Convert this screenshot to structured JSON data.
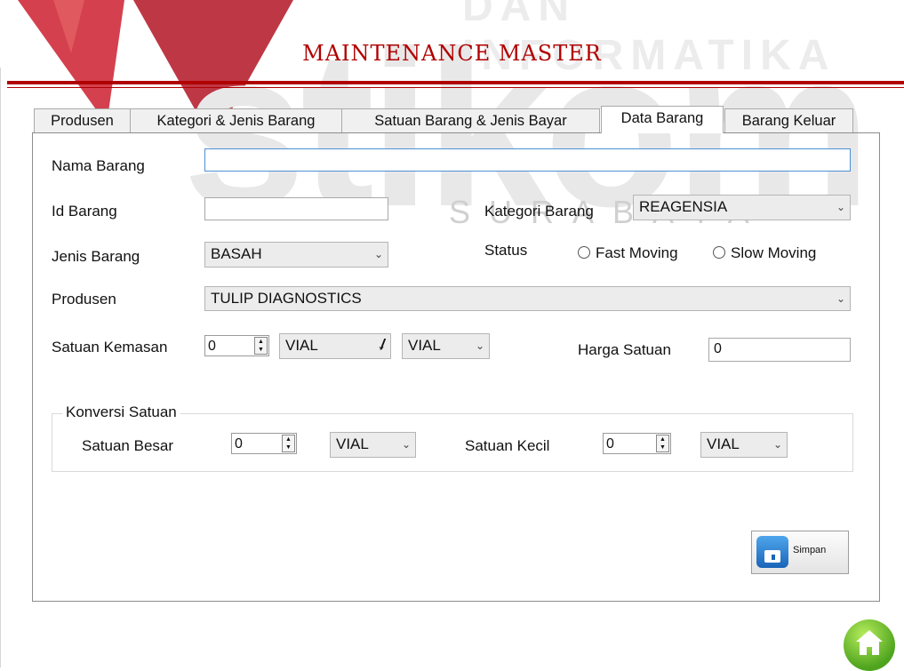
{
  "watermark": {
    "top_text": "DAN INFORMATIKA",
    "brand": "stikom",
    "city": "SURABAYA"
  },
  "title": "MAINTENANCE MASTER",
  "tabs": [
    {
      "label": "Produsen"
    },
    {
      "label": "Kategori & Jenis Barang"
    },
    {
      "label": "Satuan Barang & Jenis Bayar"
    },
    {
      "label": "Data Barang",
      "active": true
    },
    {
      "label": "Barang Keluar"
    }
  ],
  "form": {
    "nama_barang": {
      "label": "Nama Barang",
      "value": ""
    },
    "id_barang": {
      "label": "Id Barang",
      "value": ""
    },
    "kategori_barang": {
      "label": "Kategori Barang",
      "value": "REAGENSIA"
    },
    "jenis_barang": {
      "label": "Jenis Barang",
      "value": "BASAH"
    },
    "status": {
      "label": "Status",
      "options": [
        "Fast Moving",
        "Slow Moving"
      ],
      "selected": null
    },
    "produsen": {
      "label": "Produsen",
      "value": "TULIP DIAGNOSTICS"
    },
    "satuan_kemasan": {
      "label": "Satuan Kemasan",
      "qty": "0",
      "unit1": "VIAL",
      "separator": "/",
      "unit2": "VIAL"
    },
    "harga_satuan": {
      "label": "Harga Satuan",
      "value": "0"
    }
  },
  "konversi": {
    "title": "Konversi Satuan",
    "besar": {
      "label": "Satuan Besar",
      "qty": "0",
      "unit": "VIAL"
    },
    "kecil": {
      "label": "Satuan Kecil",
      "qty": "0",
      "unit": "VIAL"
    }
  },
  "save_label": "Simpan",
  "icons": {
    "save": "floppy-disk-icon",
    "home": "home-icon",
    "dropdown": "chevron-down-icon",
    "spinner": "spinner-up-down-icon"
  }
}
